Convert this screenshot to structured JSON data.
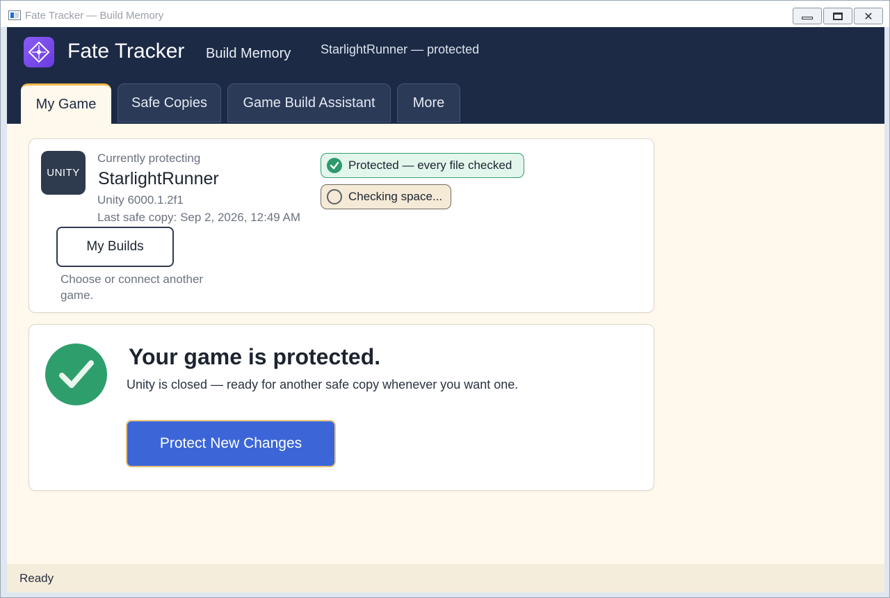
{
  "window": {
    "title": "Fate Tracker — Build Memory",
    "controls": {
      "minimize": "minimize",
      "maximize": "maximize",
      "close": "✕"
    }
  },
  "header": {
    "brand": "Fate Tracker",
    "subtitle": "Build Memory",
    "status": "StarlightRunner — protected",
    "logo_icon": "compass-diamond-icon",
    "accent_color": "#7c4dff"
  },
  "tabs": [
    {
      "label": "My Game",
      "active": true
    },
    {
      "label": "Safe Copies",
      "active": false
    },
    {
      "label": "Game Build Assistant",
      "active": false
    },
    {
      "label": "More",
      "active": false
    }
  ],
  "project_card": {
    "tile_label": "UNITY",
    "current_label": "Currently protecting",
    "project_name": "StarlightRunner",
    "unity_version": "Unity 6000.1.2f1",
    "last_safe_copy": "Last safe copy: Sep 2, 2026, 12:49 AM",
    "builds_button": "My Builds",
    "choose_text": "Choose or connect another game.",
    "status_pills": [
      {
        "label": "Protected — every file checked",
        "icon": "check-circle-icon",
        "color": "#2d9a6c"
      },
      {
        "label": "Checking space...",
        "icon": "empty-circle-icon",
        "color": "#5c5f66"
      }
    ]
  },
  "protection_card": {
    "title": "Your game is protected.",
    "subtitle": "Unity is closed — ready for another safe copy whenever you want one.",
    "action_button": "Protect New Changes",
    "icon": "large-check-icon",
    "button_color": "#3c66d8"
  },
  "statusbar": {
    "text": "Ready"
  }
}
